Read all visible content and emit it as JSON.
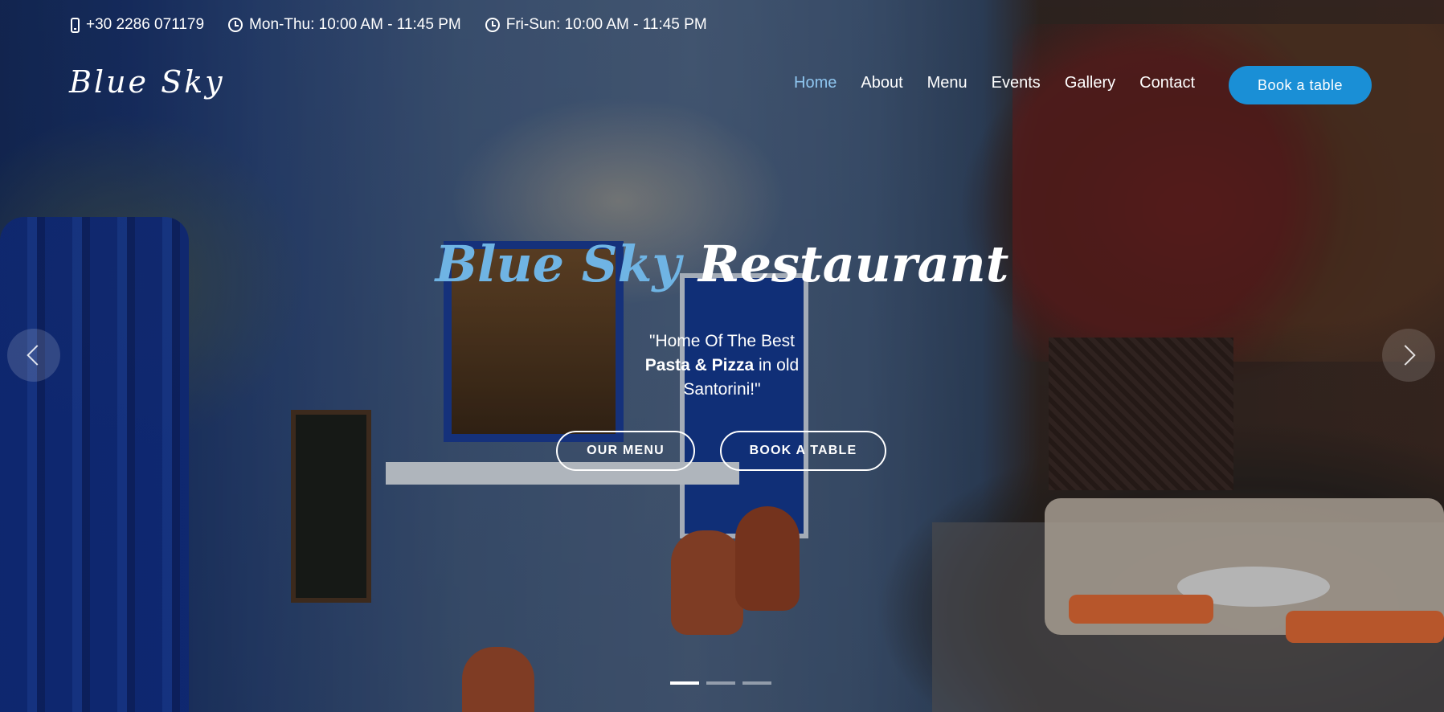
{
  "topbar": {
    "phone": "+30 2286 071179",
    "hours_weekday": "Mon-Thu: 10:00 AM - 11:45 PM",
    "hours_weekend": "Fri-Sun: 10:00 AM - 11:45 PM"
  },
  "header": {
    "logo": "Blue Sky",
    "nav": [
      {
        "label": "Home",
        "active": true
      },
      {
        "label": "About"
      },
      {
        "label": "Menu"
      },
      {
        "label": "Events"
      },
      {
        "label": "Gallery"
      },
      {
        "label": "Contact"
      }
    ],
    "book_button": "Book a table"
  },
  "hero": {
    "title_part1": "Blue Sky",
    "title_part2": "Restaurant",
    "tagline_line1": "\"Home Of The Best",
    "tagline_bold": "Pasta & Pizza",
    "tagline_rest": " in old",
    "tagline_line3": "Santorini!\"",
    "cta_menu": "OUR MENU",
    "cta_book": "BOOK A TABLE"
  },
  "carousel": {
    "slides": 3,
    "active_index": 0
  },
  "colors": {
    "accent": "#1a8fd6",
    "title_blue": "#6fb4e4",
    "nav_active": "#8fc6f0"
  },
  "icons": [
    "phone-icon",
    "clock-icon",
    "chevron-left-icon",
    "chevron-right-icon"
  ]
}
